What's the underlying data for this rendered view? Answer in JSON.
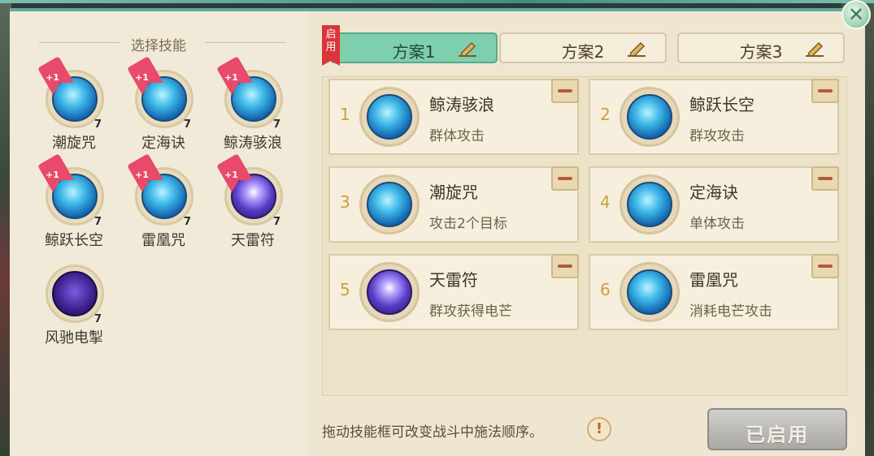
{
  "left_panel": {
    "title": "选择技能",
    "skills": [
      {
        "name": "潮旋咒",
        "level": "7",
        "badge": "+1",
        "style": "blue"
      },
      {
        "name": "定海诀",
        "level": "7",
        "badge": "+1",
        "style": "blue"
      },
      {
        "name": "鲸涛骇浪",
        "level": "7",
        "badge": "+1",
        "style": "blue"
      },
      {
        "name": "鲸跃长空",
        "level": "7",
        "badge": "+1",
        "style": "blue"
      },
      {
        "name": "雷凰咒",
        "level": "7",
        "badge": "+1",
        "style": "blue"
      },
      {
        "name": "天雷符",
        "level": "7",
        "badge": "+1",
        "style": "purple"
      },
      {
        "name": "风驰电掣",
        "level": "7",
        "badge": "",
        "style": "dark"
      }
    ]
  },
  "tabs": [
    {
      "label": "方案1",
      "active": true
    },
    {
      "label": "方案2",
      "active": false
    },
    {
      "label": "方案3",
      "active": false
    }
  ],
  "enabled_badge": "启用",
  "slots": [
    {
      "num": "1",
      "name": "鲸涛骇浪",
      "desc": "群体攻击",
      "style": "blue"
    },
    {
      "num": "2",
      "name": "鲸跃长空",
      "desc": "群攻攻击",
      "style": "blue"
    },
    {
      "num": "3",
      "name": "潮旋咒",
      "desc": "攻击2个目标",
      "style": "blue"
    },
    {
      "num": "4",
      "name": "定海诀",
      "desc": "单体攻击",
      "style": "blue"
    },
    {
      "num": "5",
      "name": "天雷符",
      "desc": "群攻获得电芒",
      "style": "purple"
    },
    {
      "num": "6",
      "name": "雷凰咒",
      "desc": "消耗电芒攻击",
      "style": "blue"
    }
  ],
  "hint": "拖动技能框可改变战斗中施法顺序。",
  "info_symbol": "!",
  "close_symbol": "✕",
  "enabled_button": "已启用",
  "colors": {
    "accent": "#7ecfae",
    "badge_red": "#d9353a",
    "panel": "#efe6d2"
  }
}
